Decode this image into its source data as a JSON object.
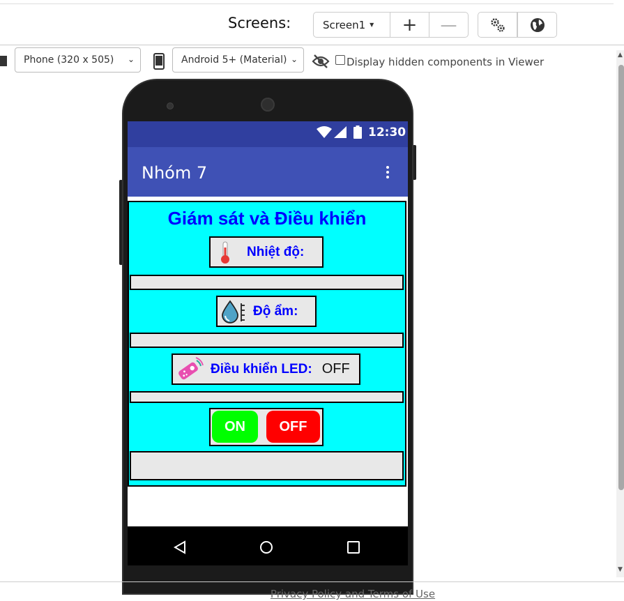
{
  "toolbar": {
    "screens_label": "Screens:",
    "screen_selected": "Screen1",
    "add_label": "+",
    "remove_label": "—"
  },
  "viewer_options": {
    "device_selected": "Phone (320 x 505)",
    "theme_selected": "Android 5+ (Material)",
    "hidden_components_label": "Display hidden components in Viewer",
    "hidden_components_checked": false
  },
  "phone": {
    "status_time": "12:30",
    "app_title": "Nhóm 7",
    "heading": "Giám sát và Điều khiển",
    "temperature_label": "Nhiệt độ:",
    "humidity_label": "Độ ẩm:",
    "led_label": "Điều khiển LED:",
    "led_value": "OFF",
    "on_button": "ON",
    "off_button": "OFF",
    "colors": {
      "status_bar": "#303f9f",
      "app_bar": "#3f51b5",
      "background": "#00ffff",
      "heading_text": "#0000ff",
      "on_button": "#00ff00",
      "off_button": "#ff0000"
    }
  },
  "footer": {
    "link": "Privacy Policy and Terms of Use"
  },
  "icons": [
    "chevron-down-icon",
    "plus-icon",
    "minus-icon",
    "gear-icon",
    "globe-icon",
    "phone-icon",
    "eye-off-icon",
    "thermometer-icon",
    "humidity-icon",
    "led-remote-icon",
    "wifi-icon",
    "signal-icon",
    "battery-icon",
    "more-vert-icon",
    "back-icon",
    "home-icon",
    "recents-icon"
  ]
}
